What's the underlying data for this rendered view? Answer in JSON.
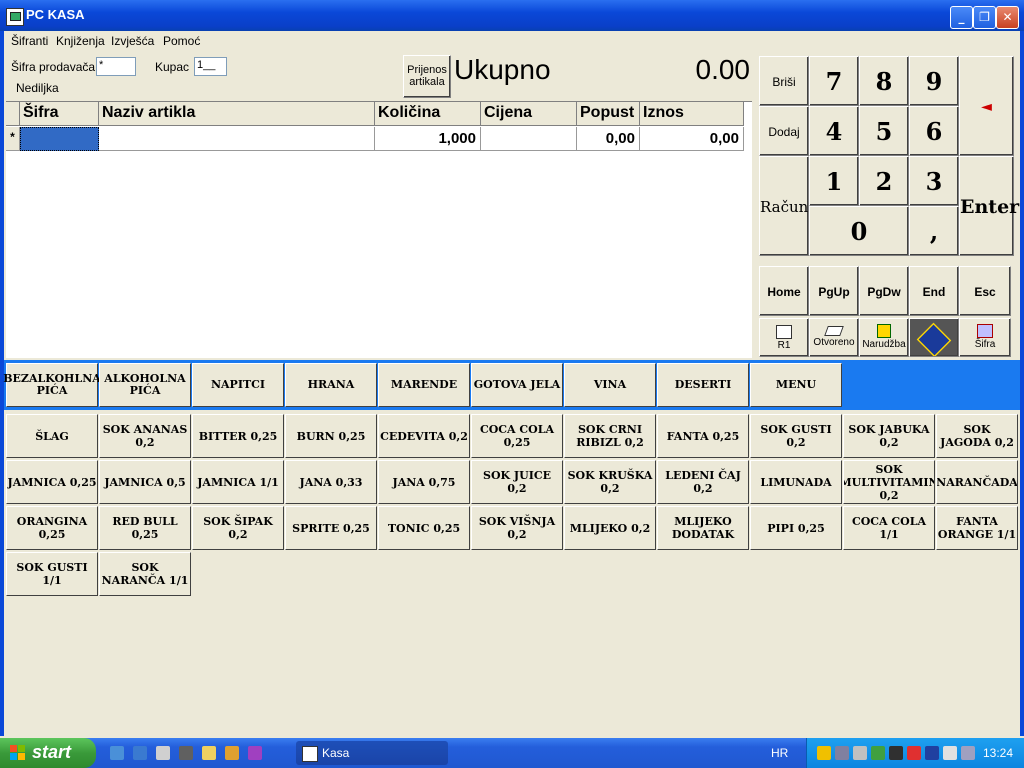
{
  "window": {
    "title": "PC KASA"
  },
  "menu": [
    "Šifranti",
    "Knjiženja",
    "Izvješća",
    "Pomoć"
  ],
  "form": {
    "sifra_label": "Šifra prodavača",
    "sifra_value": "*",
    "kupac_label": "Kupac",
    "kupac_value": "1__",
    "day_label": "Nedilјka"
  },
  "transfer_button": "Prijenos artikala",
  "total": {
    "label": "Ukupno",
    "value": "0.00"
  },
  "grid": {
    "columns": [
      "Šifra",
      "Naziv artikla",
      "Količina",
      "Cijena",
      "Popust",
      "Iznos"
    ],
    "row": {
      "marker": "*",
      "sifra": "",
      "naziv": "",
      "kolicina": "1,000",
      "cijena": "",
      "popust": "0,00",
      "iznos": "0,00"
    }
  },
  "numpad": {
    "brisi": "Briši",
    "dodaj": "Dodaj",
    "racun": "Račun",
    "enter": "Enter",
    "digits": [
      "7",
      "8",
      "9",
      "4",
      "5",
      "6",
      "1",
      "2",
      "3",
      "0",
      ","
    ],
    "back_arrow": "◄",
    "nav": [
      "Home",
      "PgUp",
      "PgDw",
      "End",
      "Esc"
    ],
    "tools": [
      {
        "label": "R1",
        "icon": "printer-icon"
      },
      {
        "label": "Otvoreno",
        "icon": "eraser-icon"
      },
      {
        "label": "Narudžba",
        "icon": "runner-icon"
      },
      {
        "label": "",
        "icon": "logo-icon"
      },
      {
        "label": "Šifra",
        "icon": "puzzle-icon"
      }
    ]
  },
  "categories": [
    "BEZALKOHLNA PIĆA",
    "ALKOHOLNA PIĆA",
    "NAPITCI",
    "HRANA",
    "MARENDE",
    "GOTOVA JELA",
    "VINA",
    "DESERTI",
    "MENU"
  ],
  "products": [
    "ŠLAG",
    "SOK ANANAS 0,2",
    "BITTER 0,25",
    "BURN 0,25",
    "CEDEVITA 0,2",
    "COCA COLA 0,25",
    "SOK CRNI RIBIZL 0,2",
    "FANTA 0,25",
    "SOK GUSTI 0,2",
    "SOK JABUKA 0,2",
    "SOK JAGODA 0,2",
    "JAMNICA 0,25",
    "JAMNICA 0,5",
    "JAMNICA 1/1",
    "JANA 0,33",
    "JANA 0,75",
    "SOK JUICE 0,2",
    "SOK KRUŠKA 0,2",
    "LEDENI ČAJ 0,2",
    "LIMUNADA",
    "SOK MULTIVITAMIN 0,2",
    "NARANČADA",
    "ORANGINA 0,25",
    "RED BULL 0,25",
    "SOK ŠIPAK 0,2",
    "SPRITE 0,25",
    "TONIC 0,25",
    "SOK VIŠNJA 0,2",
    "MLIJEKO 0,2",
    "MLIJEKO DODATAK",
    "PIPI 0,25",
    "COCA COLA 1/1",
    "FANTA ORANGE 1/1",
    "SOK GUSTI 1/1",
    "SOK NARANČA 1/1"
  ],
  "taskbar": {
    "start": "start",
    "task": "Kasa",
    "lang": "HR",
    "clock": "13:24"
  },
  "colors": {
    "title_blue": "#0a48d8",
    "tab_strip": "#1a7af0",
    "face": "#ece9d8"
  }
}
